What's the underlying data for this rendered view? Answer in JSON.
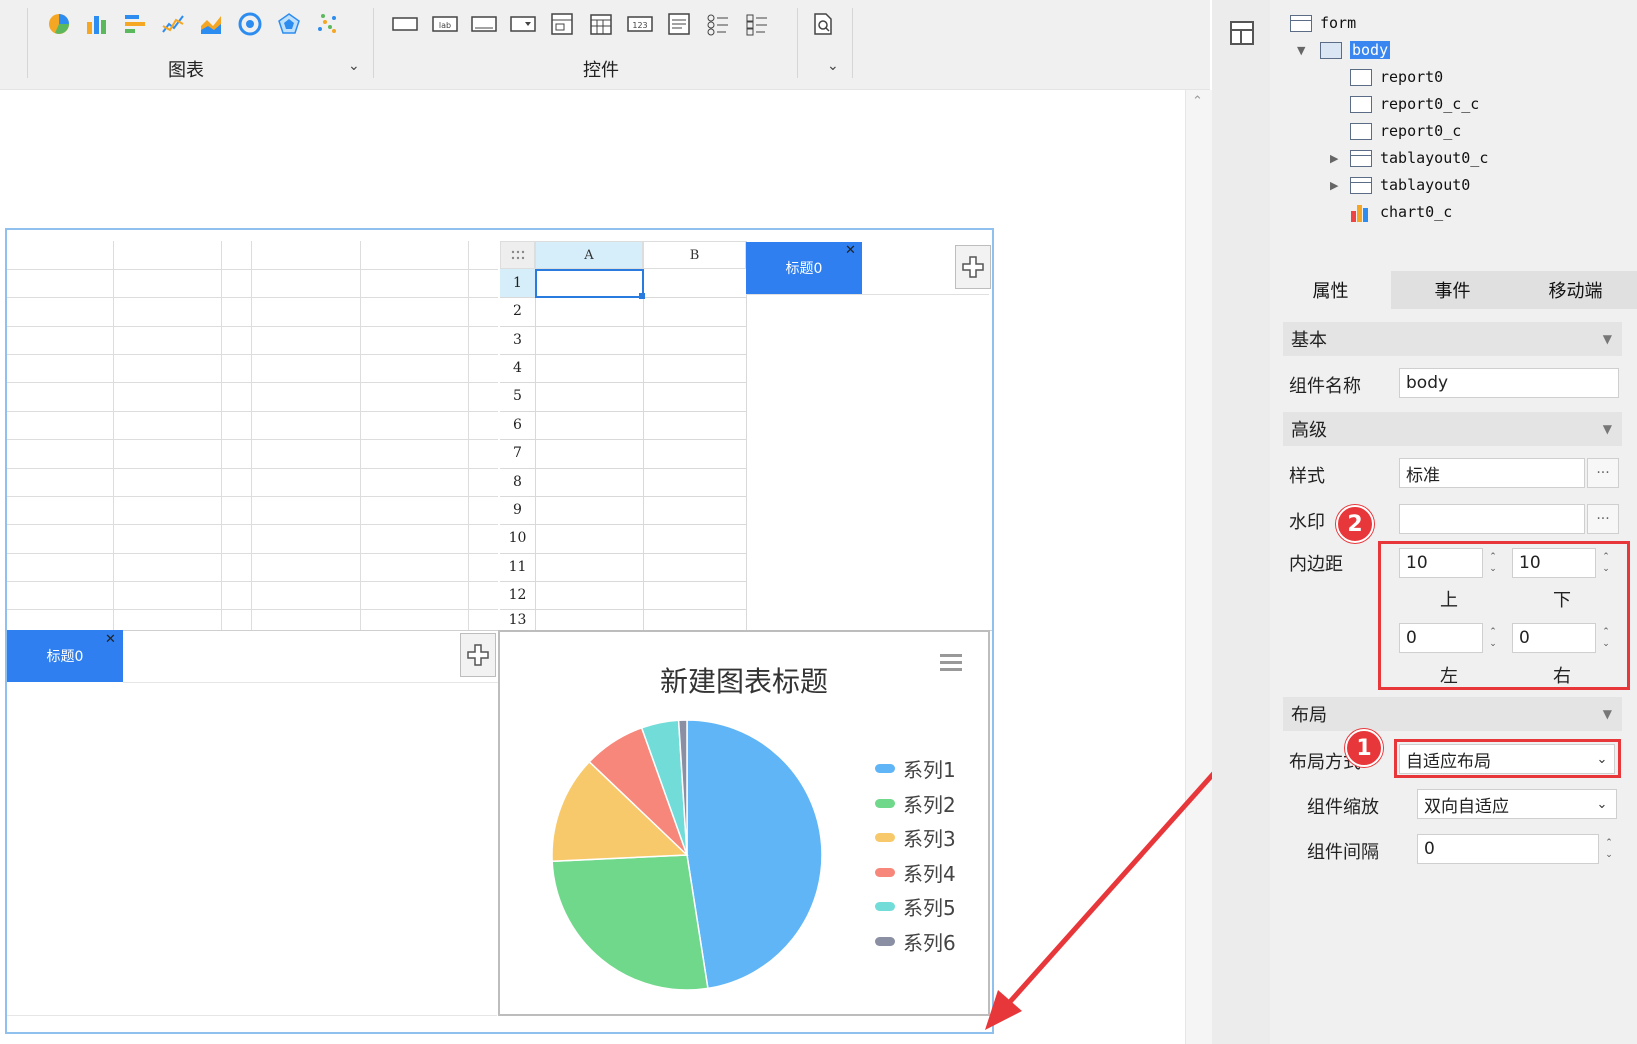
{
  "toolbar": {
    "chart_group_label": "图表",
    "widget_group_label": "控件",
    "widget_icons": [
      "lab",
      "123"
    ]
  },
  "canvas": {
    "spreadsheet": {
      "col_headers": [
        "A",
        "B"
      ],
      "row_numbers": [
        "1",
        "2",
        "3",
        "4",
        "5",
        "6",
        "7",
        "8",
        "9",
        "10",
        "11",
        "12",
        "13"
      ]
    },
    "tab_title_top": "标题0",
    "tab_title_bottom": "标题0",
    "close_glyph": "✕"
  },
  "chart_data": {
    "type": "pie",
    "title": "新建图表标题",
    "categories": [
      "系列1",
      "系列2",
      "系列3",
      "系列4",
      "系列5",
      "系列6"
    ],
    "values": [
      48,
      27,
      13,
      7.5,
      4.5,
      1
    ],
    "colors": [
      "#5fb5f5",
      "#6fd88a",
      "#f8c96a",
      "#f7877a",
      "#72dcd9",
      "#8a8fa3"
    ],
    "legend": "right"
  },
  "tree": {
    "items": [
      "form",
      "body",
      "report0",
      "report0_c_c",
      "report0_c",
      "tablayout0_c",
      "tablayout0",
      "chart0_c"
    ]
  },
  "panel": {
    "tabs": [
      "属性",
      "事件",
      "移动端"
    ],
    "sections": {
      "basic": "基本",
      "advanced": "高级",
      "layout": "布局"
    },
    "component_name_label": "组件名称",
    "component_name_value": "body",
    "style_label": "样式",
    "style_value": "标准",
    "watermark_label": "水印",
    "watermark_value": "",
    "padding_label": "内边距",
    "padding": {
      "top": "10",
      "bottom": "10",
      "left": "0",
      "right": "0",
      "top_label": "上",
      "bottom_label": "下",
      "left_label": "左",
      "right_label": "右"
    },
    "layout_mode_label": "布局方式",
    "layout_mode_value": "自适应布局",
    "scale_label": "组件缩放",
    "scale_value": "双向自适应",
    "gap_label": "组件间隔",
    "gap_value": "0",
    "more_glyph": "···"
  },
  "annotations": {
    "badge1": "1",
    "badge2": "2"
  }
}
